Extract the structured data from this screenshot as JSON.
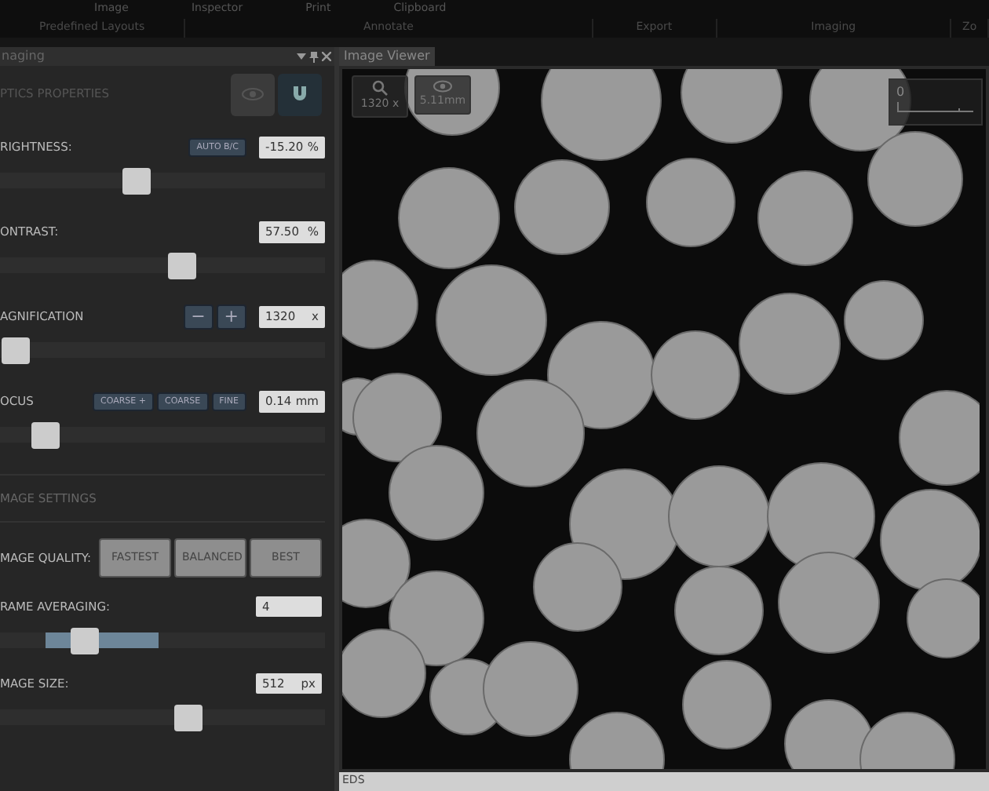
{
  "ribbon": {
    "commands": [
      "Image",
      "Inspector",
      "Print",
      "Clipboard"
    ],
    "groups": [
      "Predefined Layouts",
      "Annotate",
      "Export",
      "Imaging",
      "Zo"
    ]
  },
  "panel": {
    "title": "naging",
    "section_title": "PTICS PROPERTIES",
    "controls": [
      {
        "kind": "slider",
        "label": "RIGHTNESS:",
        "value": "-15.20",
        "unit": "%",
        "level": 0.42,
        "buttons": [
          "AUTO B/C"
        ]
      },
      {
        "kind": "slider",
        "label": "ONTRAST:",
        "value": "57.50",
        "unit": "%",
        "level": 0.56
      },
      {
        "kind": "stepper",
        "label": "AGNIFICATION",
        "value": "1320",
        "unit": "x",
        "level": 0.05,
        "buttons": [
          "−",
          "+"
        ]
      },
      {
        "kind": "slider",
        "label": "OCUS",
        "value": "0.14",
        "unit": "mm",
        "level": 0.14,
        "buttons": [
          "COARSE +",
          "COARSE",
          "FINE"
        ]
      }
    ],
    "image_settings": {
      "title": "MAGE SETTINGS",
      "quality_label": "MAGE QUALITY:",
      "quality_options": [
        {
          "label": "FASTEST",
          "selected": false
        },
        {
          "label": "BALANCED",
          "selected": false
        },
        {
          "label": "BEST",
          "selected": false
        }
      ],
      "averaging": {
        "label": "RAME AVERAGING:",
        "value": "4",
        "level": 0.26
      },
      "size": {
        "label": "MAGE SIZE:",
        "value": "512",
        "unit": "px",
        "level": 0.58
      }
    }
  },
  "viewer": {
    "tab": "Image Viewer",
    "magnification": "1320 x",
    "field_width": "5.11mm",
    "scale_label": "0"
  },
  "status_bar": "EDS"
}
